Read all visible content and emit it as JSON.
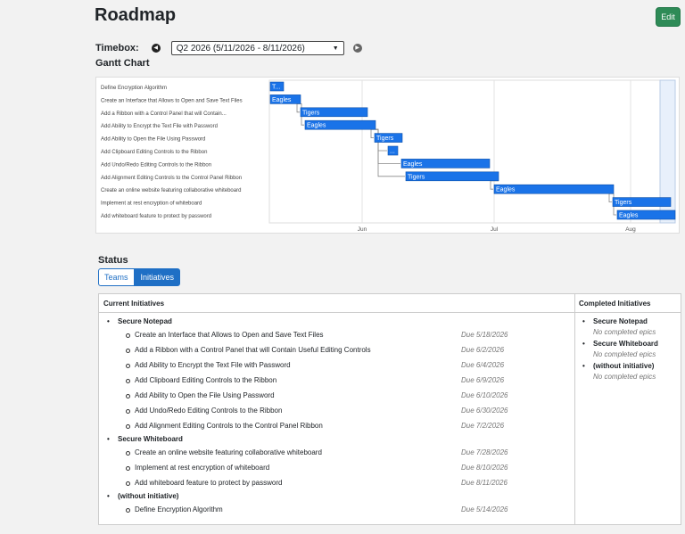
{
  "page": {
    "title": "Roadmap",
    "edit_label": "Edit"
  },
  "timebox": {
    "label": "Timebox:",
    "selected": "Q2 2026 (5/11/2026 - 8/11/2026)",
    "prev_icon": "chevron-left-circle-icon",
    "next_icon": "chevron-right-circle-icon"
  },
  "gantt": {
    "title": "Gantt Chart",
    "months": [
      "Jun",
      "Jul",
      "Aug"
    ],
    "rows": [
      {
        "task": "Define Encryption Algorithm",
        "team": "T..."
      },
      {
        "task": "Create an Interface that Allows to Open and Save Text Files",
        "team": "Eagles"
      },
      {
        "task": "Add a Ribbon with a Control Panel that will Contain...",
        "team": "Tigers"
      },
      {
        "task": "Add Ability to Encrypt the Text File with Password",
        "team": "Eagles"
      },
      {
        "task": "Add Ability to Open the File Using Password",
        "team": "Tigers"
      },
      {
        "task": "Add Clipboard Editing Controls to the Ribbon",
        "team": "..."
      },
      {
        "task": "Add Undo/Redo Editing Controls to the Ribbon",
        "team": "Eagles"
      },
      {
        "task": "Add Alignment Editing Controls to the Control Panel Ribbon",
        "team": "Tigers"
      },
      {
        "task": "Create an online website featuring collaborative whiteboard",
        "team": "Eagles"
      },
      {
        "task": "Implement at rest encryption of whiteboard",
        "team": "Tigers"
      },
      {
        "task": "Add whiteboard feature to protect by password",
        "team": "Eagles"
      }
    ],
    "bar_color": "#1a73e8"
  },
  "status": {
    "title": "Status",
    "tabs": [
      "Teams",
      "Initiatives"
    ],
    "active_tab": "Initiatives",
    "current_header": "Current Initiatives",
    "completed_header": "Completed Initiatives",
    "current": [
      {
        "name": "Secure Notepad",
        "epics": [
          {
            "name": "Create an Interface that Allows to Open and Save Text Files",
            "due": "Due 5/18/2026"
          },
          {
            "name": "Add a Ribbon with a Control Panel that will Contain Useful Editing Controls",
            "due": "Due 6/2/2026"
          },
          {
            "name": "Add Ability to Encrypt the Text File with Password",
            "due": "Due 6/4/2026"
          },
          {
            "name": "Add Clipboard Editing Controls to the Ribbon",
            "due": "Due 6/9/2026"
          },
          {
            "name": "Add Ability to Open the File Using Password",
            "due": "Due 6/10/2026"
          },
          {
            "name": "Add Undo/Redo Editing Controls to the Ribbon",
            "due": "Due 6/30/2026"
          },
          {
            "name": "Add Alignment Editing Controls to the Control Panel Ribbon",
            "due": "Due 7/2/2026"
          }
        ]
      },
      {
        "name": "Secure Whiteboard",
        "epics": [
          {
            "name": "Create an online website featuring collaborative whiteboard",
            "due": "Due 7/28/2026"
          },
          {
            "name": "Implement at rest encryption of whiteboard",
            "due": "Due 8/10/2026"
          },
          {
            "name": "Add whiteboard feature to protect by password",
            "due": "Due 8/11/2026"
          }
        ]
      },
      {
        "name": "(without initiative)",
        "epics": [
          {
            "name": "Define Encryption Algorithm",
            "due": "Due 5/14/2026"
          }
        ]
      }
    ],
    "completed": [
      {
        "name": "Secure Notepad",
        "note": "No completed epics"
      },
      {
        "name": "Secure Whiteboard",
        "note": "No completed epics"
      },
      {
        "name": "(without initiative)",
        "note": "No completed epics"
      }
    ]
  }
}
